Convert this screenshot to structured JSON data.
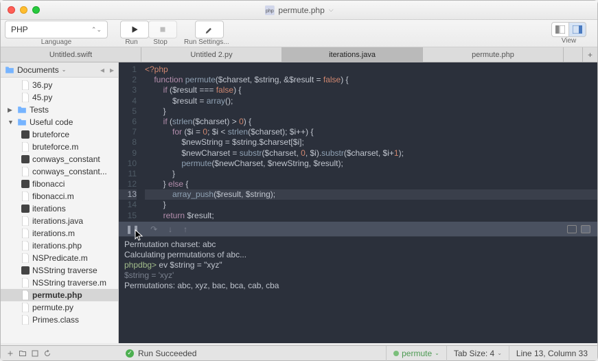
{
  "window": {
    "title": "permute.php"
  },
  "toolbar": {
    "language": "PHP",
    "language_label": "Language",
    "run_label": "Run",
    "stop_label": "Stop",
    "settings_label": "Run Settings...",
    "view_label": "View"
  },
  "tabs": [
    {
      "label": "Untitled.swift",
      "active": false
    },
    {
      "label": "Untitled 2.py",
      "active": false
    },
    {
      "label": "iterations.java",
      "active": true
    },
    {
      "label": "permute.php",
      "active": false
    }
  ],
  "sidebar": {
    "root": "Documents",
    "items": [
      {
        "label": "36.py",
        "depth": 1,
        "type": "file"
      },
      {
        "label": "45.py",
        "depth": 1,
        "type": "file"
      },
      {
        "label": "Tests",
        "depth": 0,
        "type": "folder",
        "expanded": false
      },
      {
        "label": "Useful code",
        "depth": 0,
        "type": "folder",
        "expanded": true
      },
      {
        "label": "bruteforce",
        "depth": 1,
        "type": "exec"
      },
      {
        "label": "bruteforce.m",
        "depth": 1,
        "type": "file"
      },
      {
        "label": "conways_constant",
        "depth": 1,
        "type": "exec"
      },
      {
        "label": "conways_constant...",
        "depth": 1,
        "type": "file"
      },
      {
        "label": "fibonacci",
        "depth": 1,
        "type": "exec"
      },
      {
        "label": "fibonacci.m",
        "depth": 1,
        "type": "file"
      },
      {
        "label": "iterations",
        "depth": 1,
        "type": "exec"
      },
      {
        "label": "iterations.java",
        "depth": 1,
        "type": "file"
      },
      {
        "label": "iterations.m",
        "depth": 1,
        "type": "file"
      },
      {
        "label": "iterations.php",
        "depth": 1,
        "type": "file"
      },
      {
        "label": "NSPredicate.m",
        "depth": 1,
        "type": "file"
      },
      {
        "label": "NSString traverse",
        "depth": 1,
        "type": "exec"
      },
      {
        "label": "NSString traverse.m",
        "depth": 1,
        "type": "file"
      },
      {
        "label": "permute.php",
        "depth": 1,
        "type": "file",
        "active": true
      },
      {
        "label": "permute.py",
        "depth": 1,
        "type": "file"
      },
      {
        "label": "Primes.class",
        "depth": 1,
        "type": "file"
      }
    ]
  },
  "editor": {
    "lines": [
      "<?php",
      "    function permute($charset, $string, &$result = false) {",
      "        if ($result === false) {",
      "            $result = array();",
      "        }",
      "        if (strlen($charset) > 0) {",
      "            for ($i = 0; $i < strlen($charset); $i++) {",
      "                $newString = $string.$charset[$i];",
      "                $newCharset = substr($charset, 0, $i).substr($charset, $i+1);",
      "                permute($newCharset, $newString, $result);",
      "            }",
      "        } else {",
      "            array_push($result, $string);",
      "        }",
      "        return $result;"
    ],
    "highlighted_line": 13
  },
  "console": {
    "lines": [
      {
        "text": "Permutation charset: abc"
      },
      {
        "text": "Calculating permutations of abc..."
      },
      {
        "prompt": "phpdbg>",
        "cmd": " ev $string = \"xyz\""
      },
      {
        "dim": "$string = 'xyz'"
      },
      {
        "text": "Permutations: abc, xyz, bac, bca, cab, cba"
      }
    ]
  },
  "statusbar": {
    "run_status": "Run Succeeded",
    "runner": "permute",
    "tab_size": "Tab Size: 4",
    "position": "Line 13, Column 33"
  }
}
